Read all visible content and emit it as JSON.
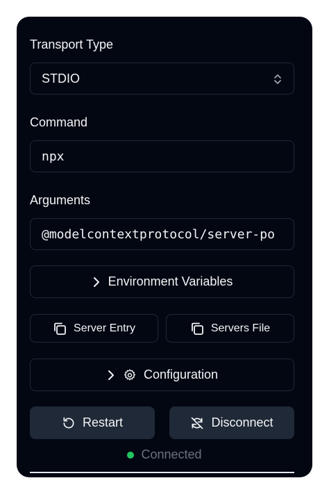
{
  "transport": {
    "label": "Transport Type",
    "value": "STDIO"
  },
  "command": {
    "label": "Command",
    "value": "npx"
  },
  "arguments": {
    "label": "Arguments",
    "value": "@modelcontextprotocol/server-po"
  },
  "buttons": {
    "env_vars": "Environment Variables",
    "server_entry": "Server Entry",
    "servers_file": "Servers File",
    "configuration": "Configuration",
    "restart": "Restart",
    "disconnect": "Disconnect"
  },
  "status": {
    "text": "Connected",
    "color": "#22c55e"
  },
  "colors": {
    "panel_bg": "#030712",
    "border": "#1f2937",
    "text": "#f3f4f6",
    "muted": "#6b7280"
  }
}
